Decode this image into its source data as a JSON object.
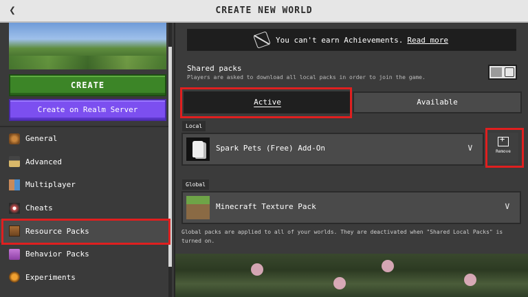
{
  "titlebar": {
    "title": "CREATE NEW WORLD",
    "back_icon": "chevron-left"
  },
  "left_panel": {
    "create_label": "CREATE",
    "realm_label": "Create on Realm Server",
    "nav": [
      {
        "label": "General",
        "icon": "general-icon"
      },
      {
        "label": "Advanced",
        "icon": "advanced-icon"
      },
      {
        "label": "Multiplayer",
        "icon": "multiplayer-icon"
      },
      {
        "label": "Cheats",
        "icon": "cheats-icon"
      },
      {
        "label": "Resource Packs",
        "icon": "resource-packs-icon",
        "selected": true
      },
      {
        "label": "Behavior Packs",
        "icon": "behavior-packs-icon"
      },
      {
        "label": "Experiments",
        "icon": "experiments-icon"
      }
    ]
  },
  "achievements": {
    "text": "You can't earn Achievements.",
    "link": "Read more"
  },
  "shared_packs": {
    "title": "Shared packs",
    "description": "Players are asked to download all local packs in order to join the game.",
    "toggle_on": false
  },
  "tabs": {
    "active": "Active",
    "available": "Available"
  },
  "local": {
    "label": "Local",
    "pack_name": "Spark Pets (Free) Add-On",
    "remove_label": "Remove"
  },
  "global": {
    "label": "Global",
    "pack_name": "Minecraft Texture Pack",
    "note": "Global packs are applied to all of your worlds. They are deactivated when \"Shared Local Packs\" is turned on."
  },
  "colors": {
    "highlight": "#e01f1f",
    "create_green": "#3c8527",
    "realm_purple": "#7c4ff0"
  }
}
